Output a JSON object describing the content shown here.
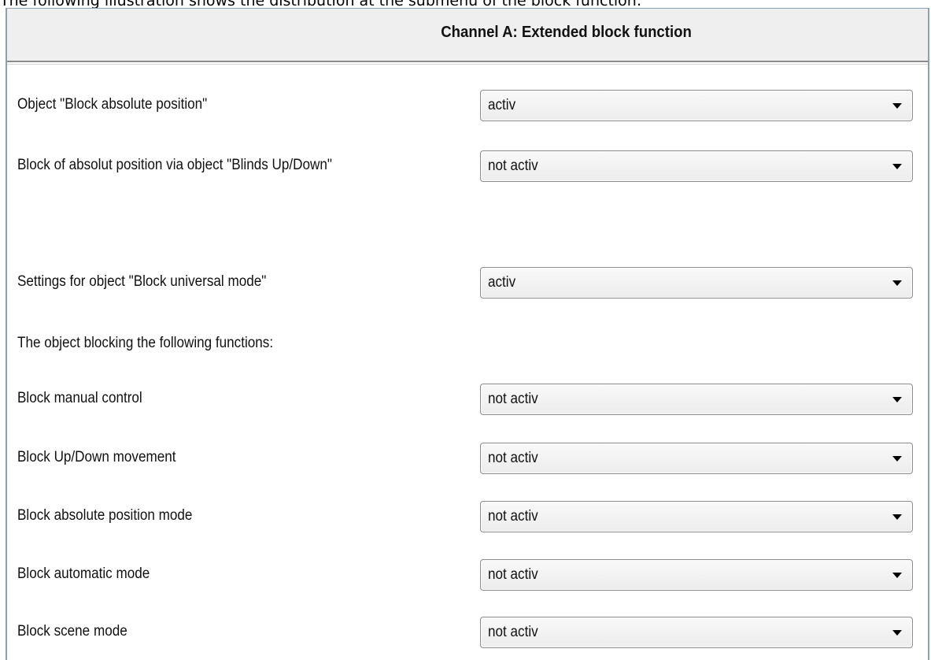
{
  "caption": "The following illustration shows the distribution at the submenu of the block function:",
  "dialog": {
    "title": "Channel A: Extended block function"
  },
  "rows": [
    {
      "label": "Object \"Block absolute position\"",
      "value": "activ"
    },
    {
      "label": "Block of absolut position via object \"Blinds Up/Down\"",
      "value": "not activ"
    },
    {
      "label": "Settings for object \"Block universal mode\"",
      "value": "activ"
    },
    {
      "label": "The object blocking the following functions:"
    },
    {
      "label": "Block manual control",
      "value": "not activ"
    },
    {
      "label": "Block Up/Down movement",
      "value": "not activ"
    },
    {
      "label": "Block absolute position mode",
      "value": "not activ"
    },
    {
      "label": "Block automatic mode",
      "value": "not activ"
    },
    {
      "label": "Block scene mode",
      "value": "not activ"
    }
  ],
  "icons": {
    "dropdown": "chevron-down-icon"
  }
}
